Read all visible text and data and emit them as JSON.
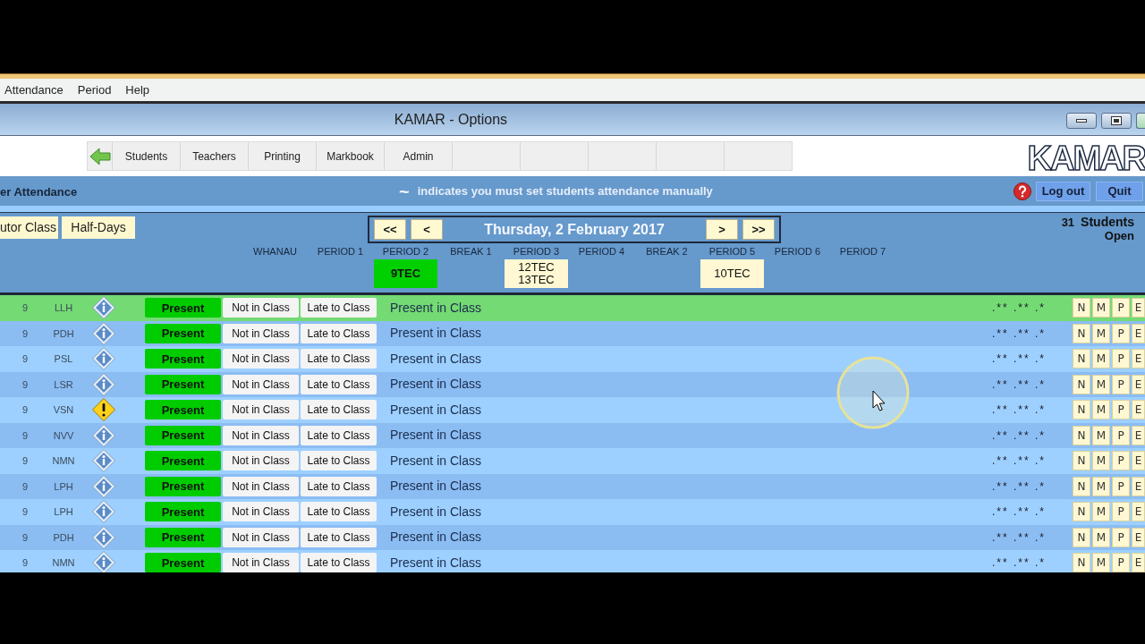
{
  "menu": [
    {
      "label": "Attendance"
    },
    {
      "label": "Period"
    },
    {
      "label": "Help"
    }
  ],
  "window": {
    "title": "KAMAR - Options"
  },
  "toolbar": {
    "tabs": [
      {
        "label": "Students"
      },
      {
        "label": "Teachers"
      },
      {
        "label": "Printing"
      },
      {
        "label": "Markbook"
      },
      {
        "label": "Admin"
      }
    ],
    "logo": "KAMAR"
  },
  "header": {
    "title": "er Attendance",
    "notice_symbol": "~",
    "notice": "indicates you must set students attendance manually",
    "buttons": [
      {
        "label": "Log out"
      },
      {
        "label": "Quit"
      }
    ]
  },
  "filters": [
    {
      "label": "utor Class"
    },
    {
      "label": "Half-Days"
    }
  ],
  "date_nav": {
    "back": [
      {
        "label": "<<"
      },
      {
        "label": "<"
      }
    ],
    "date": "Thursday, 2 February 2017",
    "forward": [
      {
        "label": ">"
      },
      {
        "label": ">>"
      }
    ]
  },
  "summary": {
    "count": "31",
    "label": "Students",
    "status": "Open"
  },
  "periods": [
    {
      "label": "WHANAU"
    },
    {
      "label": "PERIOD 1"
    },
    {
      "label": "PERIOD 2",
      "class_box": {
        "lines": [
          "9TEC"
        ],
        "selected": true
      }
    },
    {
      "label": "BREAK 1"
    },
    {
      "label": "PERIOD 3",
      "class_box": {
        "lines": [
          "12TEC",
          "13TEC"
        ],
        "selected": false
      }
    },
    {
      "label": "PERIOD 4"
    },
    {
      "label": "BREAK 2"
    },
    {
      "label": "PERIOD 5",
      "class_box": {
        "lines": [
          "10TEC"
        ],
        "selected": false
      }
    },
    {
      "label": "PERIOD 6"
    },
    {
      "label": "PERIOD 7"
    }
  ],
  "rows": [
    {
      "year": "9",
      "code": "LLH",
      "kind": "info",
      "selected": true,
      "options": [
        {
          "label": "Present",
          "selected": true
        },
        {
          "label": "Not in Class",
          "selected": false
        },
        {
          "label": "Late to Class",
          "selected": false
        }
      ],
      "status": "Present in Class",
      "marks": ".** .** .*",
      "codes": [
        {
          "label": "N"
        },
        {
          "label": "M"
        },
        {
          "label": "P"
        },
        {
          "label": "E"
        }
      ]
    },
    {
      "year": "9",
      "code": "PDH",
      "kind": "info",
      "selected": false,
      "options": [
        {
          "label": "Present",
          "selected": true
        },
        {
          "label": "Not in Class",
          "selected": false
        },
        {
          "label": "Late to Class",
          "selected": false
        }
      ],
      "status": "Present in Class",
      "marks": ".** .** .*",
      "codes": [
        {
          "label": "N"
        },
        {
          "label": "M"
        },
        {
          "label": "P"
        },
        {
          "label": "E"
        }
      ]
    },
    {
      "year": "9",
      "code": "PSL",
      "kind": "info",
      "selected": false,
      "options": [
        {
          "label": "Present",
          "selected": true
        },
        {
          "label": "Not in Class",
          "selected": false
        },
        {
          "label": "Late to Class",
          "selected": false
        }
      ],
      "status": "Present in Class",
      "marks": ".** .** .*",
      "codes": [
        {
          "label": "N"
        },
        {
          "label": "M"
        },
        {
          "label": "P"
        },
        {
          "label": "E"
        }
      ]
    },
    {
      "year": "9",
      "code": "LSR",
      "kind": "info",
      "selected": false,
      "options": [
        {
          "label": "Present",
          "selected": true
        },
        {
          "label": "Not in Class",
          "selected": false
        },
        {
          "label": "Late to Class",
          "selected": false
        }
      ],
      "status": "Present in Class",
      "marks": ".** .** .*",
      "codes": [
        {
          "label": "N"
        },
        {
          "label": "M"
        },
        {
          "label": "P"
        },
        {
          "label": "E"
        }
      ]
    },
    {
      "year": "9",
      "code": "VSN",
      "kind": "warning",
      "selected": false,
      "options": [
        {
          "label": "Present",
          "selected": true
        },
        {
          "label": "Not in Class",
          "selected": false
        },
        {
          "label": "Late to Class",
          "selected": false
        }
      ],
      "status": "Present in Class",
      "marks": ".** .** .*",
      "codes": [
        {
          "label": "N"
        },
        {
          "label": "M"
        },
        {
          "label": "P"
        },
        {
          "label": "E"
        }
      ]
    },
    {
      "year": "9",
      "code": "NVV",
      "kind": "info",
      "selected": false,
      "options": [
        {
          "label": "Present",
          "selected": true
        },
        {
          "label": "Not in Class",
          "selected": false
        },
        {
          "label": "Late to Class",
          "selected": false
        }
      ],
      "status": "Present in Class",
      "marks": ".** .** .*",
      "codes": [
        {
          "label": "N"
        },
        {
          "label": "M"
        },
        {
          "label": "P"
        },
        {
          "label": "E"
        }
      ]
    },
    {
      "year": "9",
      "code": "NMN",
      "kind": "info",
      "selected": false,
      "options": [
        {
          "label": "Present",
          "selected": true
        },
        {
          "label": "Not in Class",
          "selected": false
        },
        {
          "label": "Late to Class",
          "selected": false
        }
      ],
      "status": "Present in Class",
      "marks": ".** .** .*",
      "codes": [
        {
          "label": "N"
        },
        {
          "label": "M"
        },
        {
          "label": "P"
        },
        {
          "label": "E"
        }
      ]
    },
    {
      "year": "9",
      "code": "LPH",
      "kind": "info",
      "selected": false,
      "options": [
        {
          "label": "Present",
          "selected": true
        },
        {
          "label": "Not in Class",
          "selected": false
        },
        {
          "label": "Late to Class",
          "selected": false
        }
      ],
      "status": "Present in Class",
      "marks": ".** .** .*",
      "codes": [
        {
          "label": "N"
        },
        {
          "label": "M"
        },
        {
          "label": "P"
        },
        {
          "label": "E"
        }
      ]
    },
    {
      "year": "9",
      "code": "LPH",
      "kind": "info",
      "selected": false,
      "options": [
        {
          "label": "Present",
          "selected": true
        },
        {
          "label": "Not in Class",
          "selected": false
        },
        {
          "label": "Late to Class",
          "selected": false
        }
      ],
      "status": "Present in Class",
      "marks": ".** .** .*",
      "codes": [
        {
          "label": "N"
        },
        {
          "label": "M"
        },
        {
          "label": "P"
        },
        {
          "label": "E"
        }
      ]
    },
    {
      "year": "9",
      "code": "PDH",
      "kind": "info",
      "selected": false,
      "options": [
        {
          "label": "Present",
          "selected": true
        },
        {
          "label": "Not in Class",
          "selected": false
        },
        {
          "label": "Late to Class",
          "selected": false
        }
      ],
      "status": "Present in Class",
      "marks": ".** .** .*",
      "codes": [
        {
          "label": "N"
        },
        {
          "label": "M"
        },
        {
          "label": "P"
        },
        {
          "label": "E"
        }
      ]
    },
    {
      "year": "9",
      "code": "NMN",
      "kind": "info",
      "selected": false,
      "options": [
        {
          "label": "Present",
          "selected": true
        },
        {
          "label": "Not in Class",
          "selected": false
        },
        {
          "label": "Late to Class",
          "selected": false
        }
      ],
      "status": "Present in Class",
      "marks": ".** .** .*",
      "codes": [
        {
          "label": "N"
        },
        {
          "label": "M"
        },
        {
          "label": "P"
        },
        {
          "label": "E"
        }
      ]
    }
  ]
}
